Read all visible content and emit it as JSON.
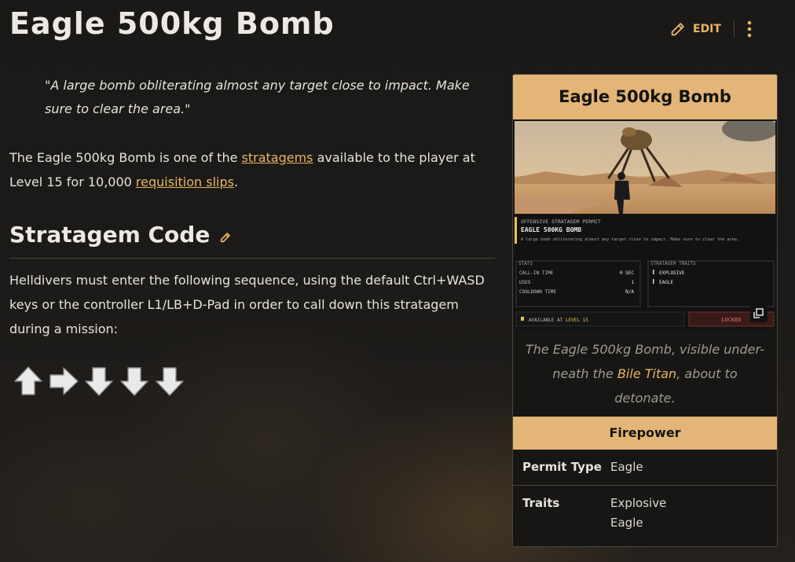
{
  "page": {
    "title": "Eagle 500kg Bomb",
    "edit_label": "EDIT"
  },
  "quote": "\"A large bomb obliterating almost any target close to impact. Make sure to clear the area.\"",
  "intro": {
    "part1": "The Eagle 500kg Bomb is one of the ",
    "link1": "stratagems",
    "part2": " available to the player at Level 15 for 10,000 ",
    "link2": "requisition slips",
    "part3": "."
  },
  "section": {
    "heading": "Stratagem Code",
    "instructions": "Helldivers must enter the following sequence, using the default Ctrl+WASD keys or the controller L1/LB+D-Pad in order to call down this stratagem during a mission:",
    "code": [
      "up",
      "right",
      "down",
      "down",
      "down"
    ]
  },
  "infobox": {
    "title": "Eagle 500kg Bomb",
    "screenshot": {
      "permit_kicker": "OFFENSIVE STRATAGEM PERMIT",
      "permit_name": "EAGLE 500KG BOMB",
      "permit_desc": "A large bomb obliterating almost any target close to impact. Make sure to clear the area.",
      "stats_header": "STATS",
      "stats": [
        {
          "label": "CALL-IN TIME",
          "value": "0 SEC"
        },
        {
          "label": "USES",
          "value": "1"
        },
        {
          "label": "COOLDOWN TIME",
          "value": "N/A"
        }
      ],
      "traits_header": "STRATAGEM TRAITS",
      "traits": [
        "EXPLOSIVE",
        "EAGLE"
      ],
      "available_prefix": "AVAILABLE AT ",
      "available_level": "LEVEL 15",
      "locked": "LOCKED"
    },
    "caption": {
      "part1": "The Eagle 500kg Bomb, visible under-neath the ",
      "link": "Bile Titan",
      "part2": ", about to detonate."
    },
    "section_title": "Firepower",
    "rows": [
      {
        "label": "Permit Type",
        "values": [
          "Eagle"
        ]
      },
      {
        "label": "Traits",
        "values": [
          "Explosive",
          "Eagle"
        ]
      }
    ]
  },
  "colors": {
    "accent": "#e8b464",
    "infobox_header": "#e3b577",
    "background": "#1c1a18"
  }
}
